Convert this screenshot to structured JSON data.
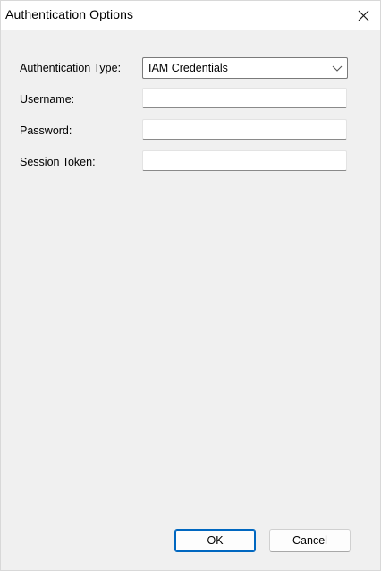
{
  "window": {
    "title": "Authentication Options"
  },
  "form": {
    "auth_type": {
      "label": "Authentication Type:",
      "selected": "IAM Credentials"
    },
    "username": {
      "label": "Username:",
      "value": ""
    },
    "password": {
      "label": "Password:",
      "value": ""
    },
    "session_token": {
      "label": "Session Token:",
      "value": ""
    }
  },
  "buttons": {
    "ok_label": "OK",
    "cancel_label": "Cancel"
  },
  "icons": {
    "close": "close-icon",
    "dropdown": "chevron-down-icon"
  },
  "colors": {
    "background": "#f0f0f0",
    "titlebar": "#ffffff",
    "default_button_border": "#0067c0"
  }
}
